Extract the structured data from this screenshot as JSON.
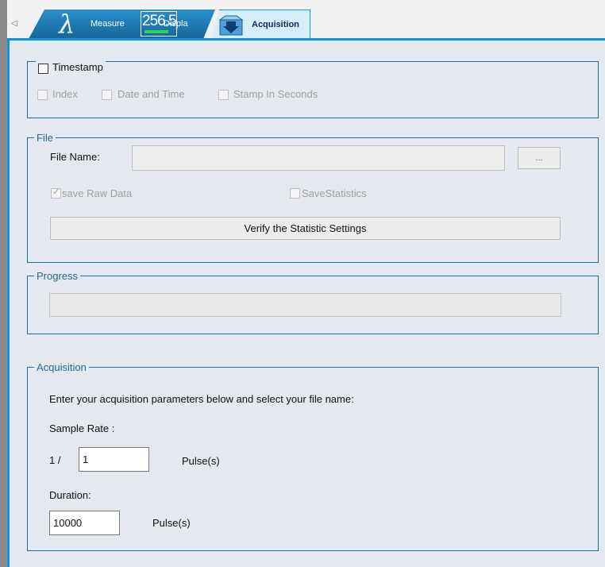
{
  "tabs": {
    "measure_label": "Measure",
    "display_label": "Displa",
    "display_icon_value": "256.5",
    "acquisition_label": "Acquisition"
  },
  "timestamp": {
    "legend": "Timestamp",
    "index_label": "Index",
    "date_time_label": "Date and Time",
    "seconds_label": "Stamp In Seconds"
  },
  "file": {
    "legend": "File",
    "name_label": "File Name:",
    "name_value": "",
    "browse_label": "...",
    "save_raw_label": "save Raw Data",
    "save_stats_label": "SaveStatistics",
    "verify_label": "Verify the Statistic Settings"
  },
  "progress": {
    "legend": "Progress",
    "value": 0
  },
  "acquisition": {
    "legend": "Acquisition",
    "instructions": "Enter your acquisition parameters below and select your file name:",
    "sample_rate_label": "Sample Rate :",
    "sample_prefix": "1 /",
    "sample_value": "1",
    "sample_unit": "Pulse(s)",
    "duration_label": "Duration:",
    "duration_value": "10000",
    "duration_unit": "Pulse(s)"
  }
}
